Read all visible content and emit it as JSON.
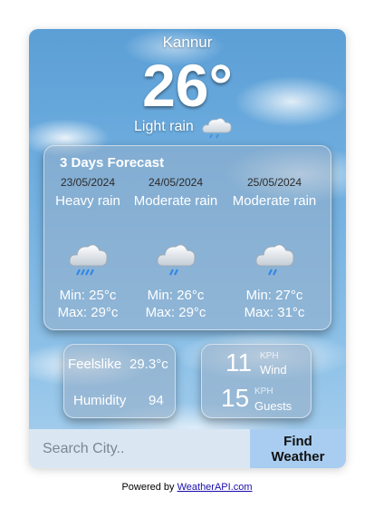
{
  "location": {
    "city": "Kannur"
  },
  "current": {
    "temperature": "26°",
    "condition": "Light rain",
    "condition_icon": "light-rain-cloud-icon"
  },
  "forecast": {
    "title": "3 Days Forecast",
    "days": [
      {
        "date": "23/05/2024",
        "condition": "Heavy rain",
        "icon": "heavy-rain-cloud-icon",
        "min": "Min: 25°c",
        "max": "Max: 29°c"
      },
      {
        "date": "24/05/2024",
        "condition": "Moderate rain",
        "icon": "moderate-rain-cloud-icon",
        "min": "Min: 26°c",
        "max": "Max: 29°c"
      },
      {
        "date": "25/05/2024",
        "condition": "Moderate rain",
        "icon": "moderate-rain-cloud-icon",
        "min": "Min: 27°c",
        "max": "Max: 31°c"
      }
    ]
  },
  "details": {
    "feelslike_label": "Feelslike",
    "feelslike_value": "29.3°c",
    "humidity_label": "Humidity",
    "humidity_value": "94",
    "wind_value": "11",
    "wind_unit": "KPH",
    "wind_label": "Wind",
    "guests_value": "15",
    "guests_unit": "KPH",
    "guests_label": "Guests"
  },
  "search": {
    "placeholder": "Search City..",
    "value": "",
    "button_label": "Find Weather"
  },
  "footer": {
    "prefix": "Powered by ",
    "link_text": "WeatherAPI.com"
  },
  "colors": {
    "sky_top": "#5b9fd6",
    "sky_bottom": "#a9d0ee",
    "input_bg": "#dae7f3",
    "button_bg": "#a9cdf0",
    "link": "#1a0dab"
  }
}
